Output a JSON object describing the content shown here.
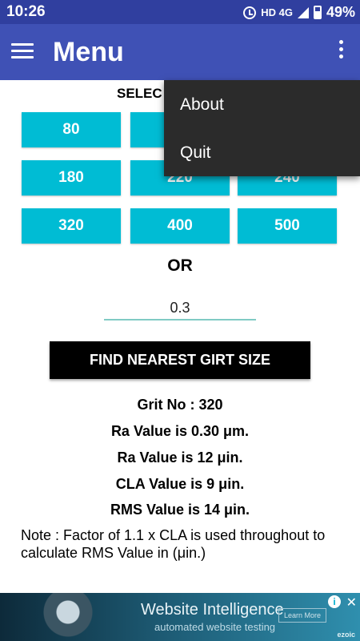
{
  "status_bar": {
    "time": "10:26",
    "network": "HD 4G",
    "battery": "49%"
  },
  "app_bar": {
    "title": "Menu"
  },
  "select_label": "SELEC",
  "grit_buttons": [
    "80",
    "",
    "",
    "180",
    "220",
    "240",
    "320",
    "400",
    "500"
  ],
  "or_label": "OR",
  "input": {
    "value": "0.3"
  },
  "find_button": "FIND NEAREST GIRT SIZE",
  "results": {
    "grit": "Grit No : 320",
    "ra_um": "Ra Value is 0.30 μm.",
    "ra_uin": "Ra Value is 12 μin.",
    "cla": "CLA Value is 9 μin.",
    "rms": "RMS Value is 14 μin."
  },
  "note": "Note : Factor of 1.1 x CLA is used throughout to calculate  RMS Value in (μin.)",
  "ad": {
    "title": "Website Intelligence",
    "subtitle": "automated website testing",
    "learn_more": "Learn More",
    "brand": "ezoic"
  },
  "popup_menu": [
    "About",
    "Quit"
  ],
  "colors": {
    "primary": "#3f51b5",
    "primary_dark": "#303f9f",
    "accent": "#00bcd4",
    "popup": "#2b2b2b"
  }
}
